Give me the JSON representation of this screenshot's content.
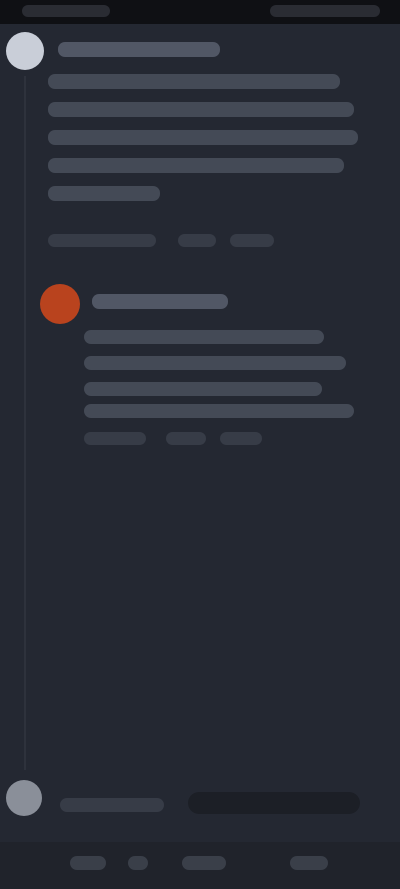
{
  "app": {
    "theme_background": "#242832",
    "status_bar_color": "#0f1014",
    "reply_avatar_color": "#b9431e"
  },
  "thread": {
    "main_post": {
      "author": "",
      "body": "",
      "meta": ""
    },
    "reply": {
      "author": "",
      "body": "",
      "meta": ""
    }
  },
  "composer": {
    "placeholder": ""
  },
  "nav": {
    "items": []
  }
}
